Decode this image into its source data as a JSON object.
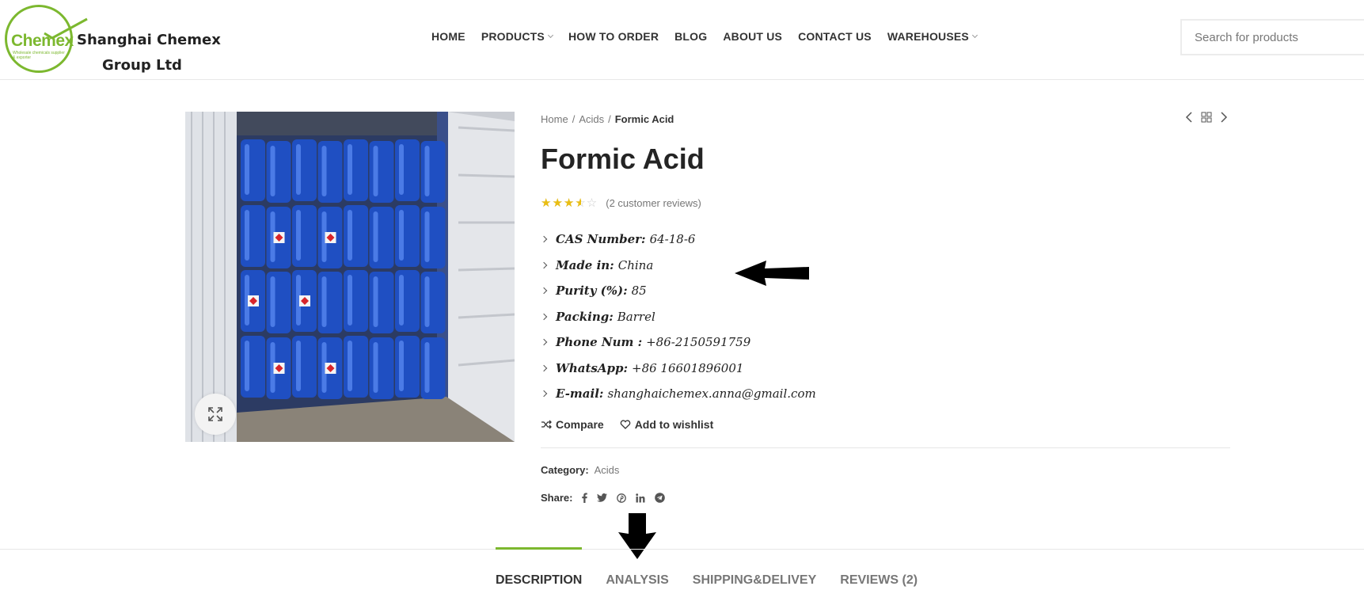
{
  "header": {
    "logo": {
      "word": "Chemex",
      "tagline": "Wholesale chemicals supplier & exporter",
      "name_line1": "Shanghai Chemex",
      "name_line2": "Group Ltd"
    },
    "nav": [
      {
        "label": "HOME",
        "has_dropdown": false
      },
      {
        "label": "PRODUCTS",
        "has_dropdown": true
      },
      {
        "label": "HOW TO ORDER",
        "has_dropdown": false
      },
      {
        "label": "BLOG",
        "has_dropdown": false
      },
      {
        "label": "ABOUT US",
        "has_dropdown": false
      },
      {
        "label": "CONTACT US",
        "has_dropdown": false
      },
      {
        "label": "WAREHOUSES",
        "has_dropdown": true
      }
    ],
    "search": {
      "placeholder": "Search for products",
      "value": ""
    }
  },
  "breadcrumb": {
    "home": "Home",
    "category": "Acids",
    "current": "Formic Acid"
  },
  "product": {
    "title": "Formic Acid",
    "rating": {
      "value": 3.5,
      "max": 5,
      "reviews_text": "(2 customer reviews)"
    },
    "attributes": [
      {
        "key": "CAS Number:",
        "value": "64-18-6"
      },
      {
        "key": "Made in:",
        "value": "China"
      },
      {
        "key": "Purity (%):",
        "value": "85"
      },
      {
        "key": "Packing:",
        "value": "Barrel"
      },
      {
        "key": "Phone Num :",
        "value": "+86-2150591759"
      },
      {
        "key": "WhatsApp:",
        "value": "+86 16601896001"
      },
      {
        "key": "E-mail:",
        "value": "shanghaichemex.anna@gmail.com"
      }
    ],
    "actions": {
      "compare": "Compare",
      "wishlist": "Add to wishlist"
    },
    "meta": {
      "category_label": "Category:",
      "category_value": "Acids",
      "share_label": "Share:"
    },
    "share_icons": [
      "facebook-icon",
      "twitter-icon",
      "pinterest-icon",
      "linkedin-icon",
      "telegram-icon"
    ]
  },
  "tabs": [
    {
      "label": "DESCRIPTION",
      "active": true
    },
    {
      "label": "ANALYSIS",
      "active": false
    },
    {
      "label": "SHIPPING&DELIVEY",
      "active": false
    },
    {
      "label": "REVIEWS (2)",
      "active": false
    }
  ],
  "colors": {
    "accent": "#7cb82f",
    "star": "#eabe12",
    "text": "#333333",
    "muted": "#777777"
  }
}
